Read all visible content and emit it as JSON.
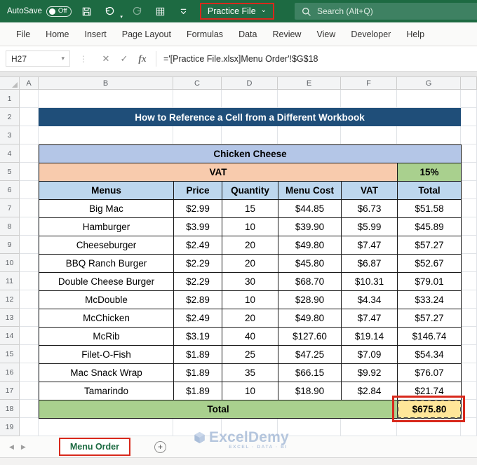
{
  "titlebar": {
    "autosave_label": "AutoSave",
    "autosave_state": "Off",
    "workbook_name": "Practice File",
    "search_placeholder": "Search (Alt+Q)"
  },
  "menubar": {
    "items": [
      "File",
      "Home",
      "Insert",
      "Page Layout",
      "Formulas",
      "Data",
      "Review",
      "View",
      "Developer",
      "Help"
    ]
  },
  "formula_bar": {
    "name_box": "H27",
    "formula": "='[Practice File.xlsx]Menu Order'!$G$18"
  },
  "glyphs": {
    "dropdown": "▾",
    "workbook_chevron": "⌄",
    "separator_dots": "⋮",
    "cancel": "✕",
    "enter": "✓",
    "fx": "fx",
    "nav_left": "◀",
    "nav_right": "▶",
    "add_sheet": "+"
  },
  "grid": {
    "column_headers": [
      "A",
      "B",
      "C",
      "D",
      "E",
      "F",
      "G"
    ],
    "row_count": 19
  },
  "sheet_content": {
    "banner_title": "How to Reference a Cell from a Different Workbook",
    "table_title": "Chicken Cheese",
    "vat_label": "VAT",
    "vat_rate": "15%",
    "headers": [
      "Menus",
      "Price",
      "Quantity",
      "Menu Cost",
      "VAT",
      "Total"
    ],
    "rows": [
      [
        "Big Mac",
        "$2.99",
        "15",
        "$44.85",
        "$6.73",
        "$51.58"
      ],
      [
        "Hamburger",
        "$3.99",
        "10",
        "$39.90",
        "$5.99",
        "$45.89"
      ],
      [
        "Cheeseburger",
        "$2.49",
        "20",
        "$49.80",
        "$7.47",
        "$57.27"
      ],
      [
        "BBQ Ranch Burger",
        "$2.29",
        "20",
        "$45.80",
        "$6.87",
        "$52.67"
      ],
      [
        "Double Cheese Burger",
        "$2.29",
        "30",
        "$68.70",
        "$10.31",
        "$79.01"
      ],
      [
        "McDouble",
        "$2.89",
        "10",
        "$28.90",
        "$4.34",
        "$33.24"
      ],
      [
        "McChicken",
        "$2.49",
        "20",
        "$49.80",
        "$7.47",
        "$57.27"
      ],
      [
        "McRib",
        "$3.19",
        "40",
        "$127.60",
        "$19.14",
        "$146.74"
      ],
      [
        "Filet-O-Fish",
        "$1.89",
        "25",
        "$47.25",
        "$7.09",
        "$54.34"
      ],
      [
        "Mac Snack Wrap",
        "$1.89",
        "35",
        "$66.15",
        "$9.92",
        "$76.07"
      ],
      [
        "Tamarindo",
        "$1.89",
        "10",
        "$18.90",
        "$2.84",
        "$21.74"
      ]
    ],
    "total_label": "Total",
    "total_value": "$675.80"
  },
  "sheet_tabs": {
    "active_tab": "Menu Order"
  },
  "watermark": {
    "brand": "ExcelDemy",
    "tagline": "EXCEL · DATA · BI"
  },
  "colors": {
    "titlebar_green": "#1d6a42",
    "banner_blue": "#1f4e79",
    "table_title_bg": "#b4c6e7",
    "vat_bg": "#f8cbad",
    "rate_bg": "#a9d08e",
    "header_bg": "#bdd7ee",
    "total_bg": "#a9d08e",
    "total_value_bg": "#ffe699",
    "annotation_red": "#d8291c"
  }
}
